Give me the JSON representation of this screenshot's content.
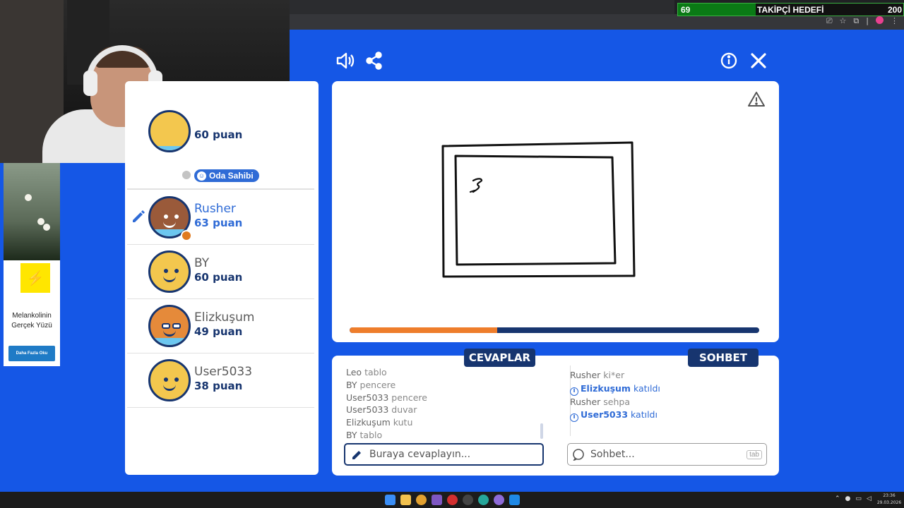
{
  "overlay": {
    "goal_current": "69",
    "goal_label": "TAKİPÇİ HEDEFİ",
    "goal_target": "200",
    "goal_progress": 0.345
  },
  "ad": {
    "title": "Melankolinin Gerçek Yüzü",
    "button": "Daha Fazla Oku"
  },
  "players": [
    {
      "name": "",
      "score": "60 puan",
      "badge": "Oda Sahibi",
      "status_color": "#c4c4c4",
      "drawing": false,
      "active": false
    },
    {
      "name": "Rusher",
      "score": "63 puan",
      "badge": "",
      "status_color": "#e07a1f",
      "drawing": true,
      "active": true
    },
    {
      "name": "BY",
      "score": "60 puan",
      "badge": "",
      "status_color": "",
      "drawing": false,
      "active": false
    },
    {
      "name": "Elizkuşum",
      "score": "49 puan",
      "badge": "",
      "status_color": "",
      "drawing": false,
      "active": false
    },
    {
      "name": "User5033",
      "score": "38 puan",
      "badge": "",
      "status_color": "",
      "drawing": false,
      "active": false
    }
  ],
  "canvas": {
    "timer_progress": 0.36,
    "timer_color": "#ee7d2b",
    "track_color": "#17356f"
  },
  "tabs": {
    "answers": "CEVAPLAR",
    "chat": "SOHBET"
  },
  "answers": [
    {
      "who": "Leo",
      "text": "tablo"
    },
    {
      "who": "BY",
      "text": "pencere"
    },
    {
      "who": "User5033",
      "text": "pencere"
    },
    {
      "who": "User5033",
      "text": "duvar"
    },
    {
      "who": "Elizkuşum",
      "text": "kutu"
    },
    {
      "who": "BY",
      "text": "tablo"
    }
  ],
  "chat": {
    "messages": [
      {
        "who": "Rusher",
        "text": "ki*er"
      },
      {
        "who": "Elizkuşum",
        "text": "katıldı",
        "system": true
      },
      {
        "who": "Rusher",
        "text": "sehpa"
      },
      {
        "who": "User5033",
        "text": "katıldı",
        "system": true
      }
    ],
    "placeholder": "Sohbet...",
    "tab_hint": "tab"
  },
  "answer_input": {
    "placeholder": "Buraya cevaplayın..."
  },
  "clock": {
    "time": "23:36",
    "date": "29.03.2026"
  },
  "colors": {
    "background": "#1557e6",
    "navy": "#17356f",
    "accent_blue": "#2f6bd6",
    "orange": "#ee7d2b"
  }
}
